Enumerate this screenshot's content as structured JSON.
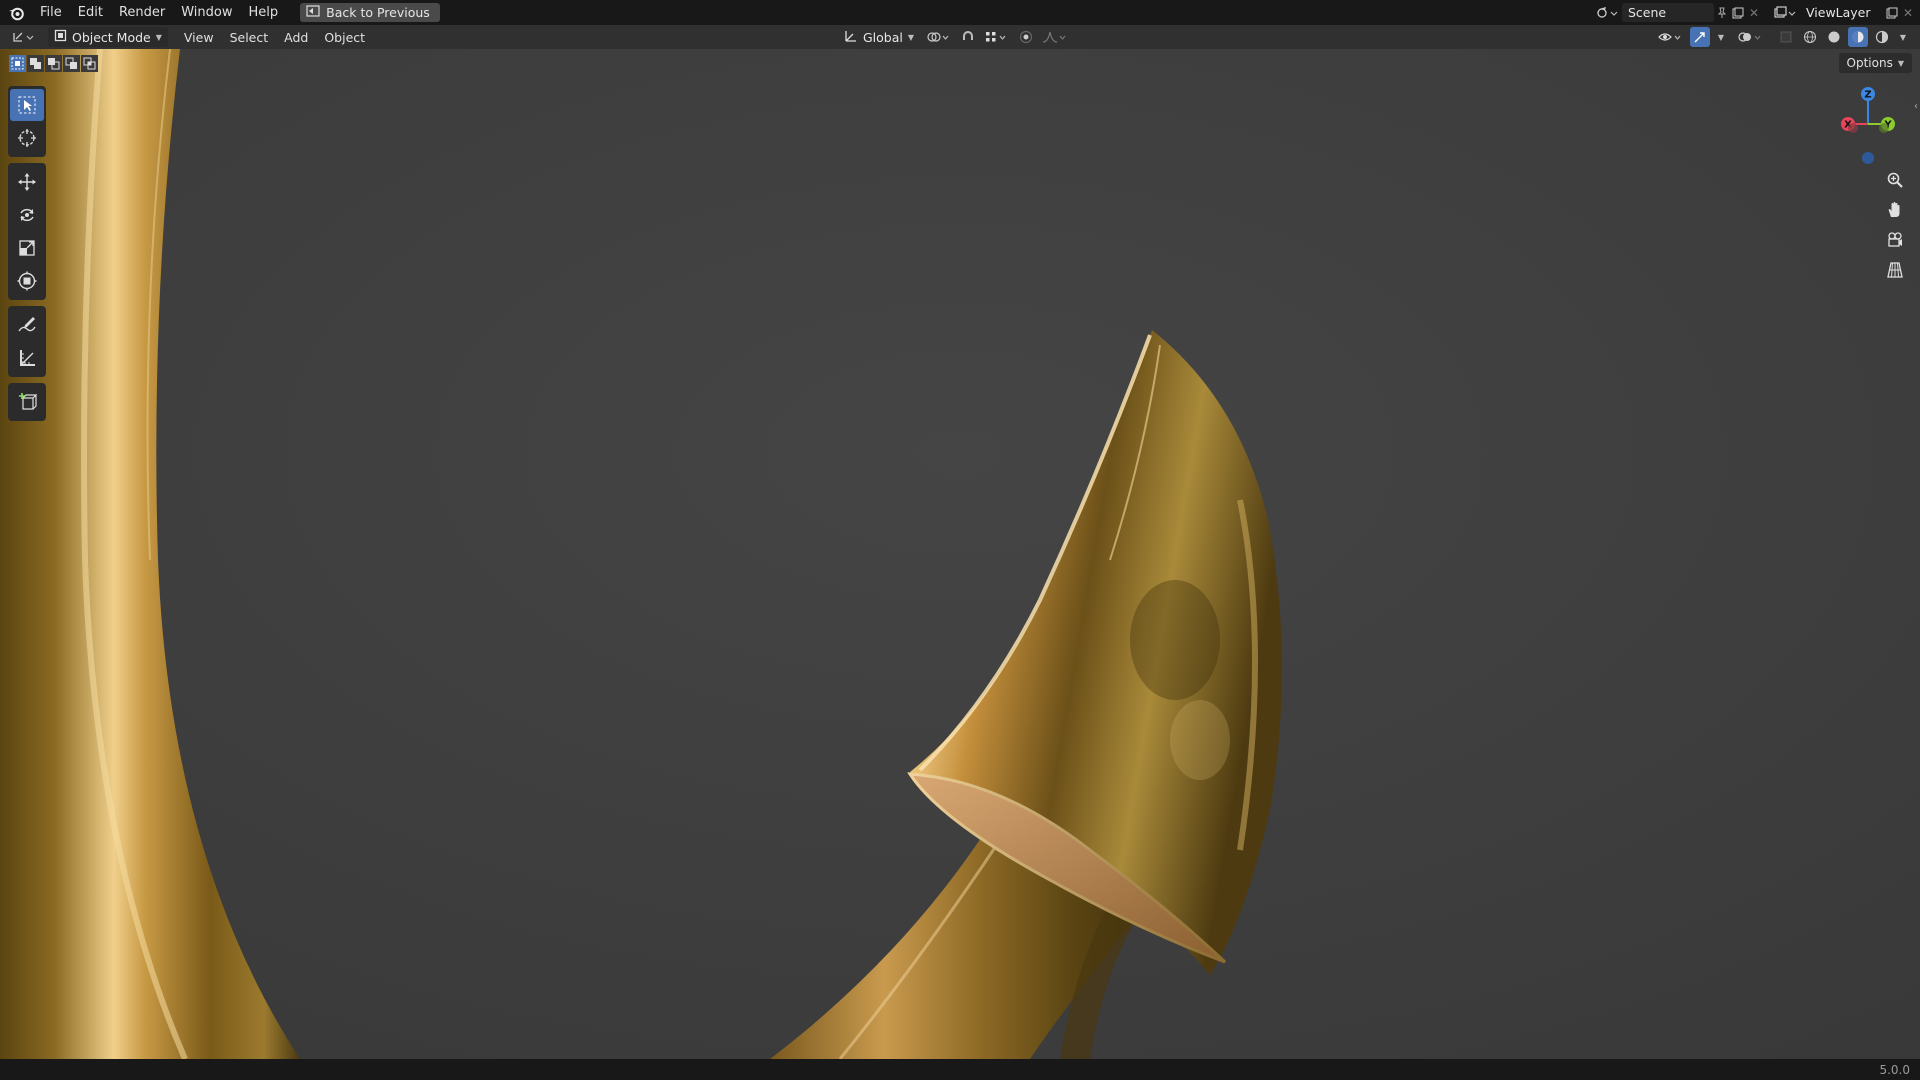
{
  "menu": {
    "items": [
      "File",
      "Edit",
      "Render",
      "Window",
      "Help"
    ],
    "back_button": "Back to Previous"
  },
  "scene": {
    "label": "Scene"
  },
  "view_layer": {
    "label": "ViewLayer"
  },
  "header": {
    "mode": "Object Mode",
    "menus": [
      "View",
      "Select",
      "Add",
      "Object"
    ],
    "orientation": "Global"
  },
  "viewport": {
    "options_label": "Options",
    "gizmo": {
      "x": "X",
      "y": "Y",
      "z": "Z"
    }
  },
  "status": {
    "version": "5.0.0"
  },
  "colors": {
    "accent": "#4772b3",
    "gold": "#c8a24a",
    "axis_x": "#e8445a",
    "axis_y": "#8ccc2e",
    "axis_z": "#3b87e2"
  }
}
